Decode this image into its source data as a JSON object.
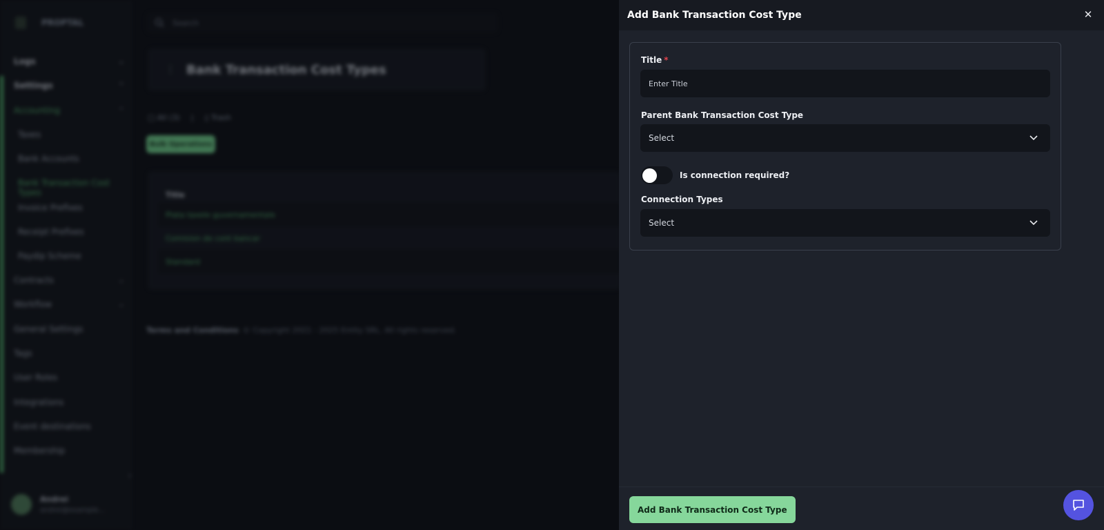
{
  "background": {
    "logo_text": "PROPTAL",
    "search_placeholder": "Search",
    "nav": [
      {
        "label": "Logs",
        "chevron": "v"
      },
      {
        "label": "Settings",
        "chevron": "^"
      },
      {
        "label": "Accounting",
        "chevron": "^"
      },
      {
        "label": "Taxes"
      },
      {
        "label": "Bank Accounts"
      },
      {
        "label": "Bank Transaction Cost Types"
      },
      {
        "label": "Invoice Prefixes"
      },
      {
        "label": "Receipt Prefixes"
      },
      {
        "label": "Paydip Scheme"
      },
      {
        "label": "Contracts",
        "chevron": "v"
      },
      {
        "label": "Workflow",
        "chevron": "v"
      },
      {
        "label": "General Settings"
      },
      {
        "label": "Tags"
      },
      {
        "label": "User Roles"
      },
      {
        "label": "Integrations"
      },
      {
        "label": "Event destinations"
      },
      {
        "label": "Membership"
      }
    ],
    "user": {
      "name": "Andrei",
      "email": "andrei@example..."
    },
    "page_title": "Bank Transaction Cost Types",
    "tool_all": "All (3)",
    "tool_trash": "Trash",
    "bulk_button": "Bulk Operations",
    "table_header": "Title",
    "rows": [
      "Plata taxele guvernamentale",
      "Comision de cont bancar",
      "Standard"
    ],
    "footer_terms": "Terms and Conditions",
    "footer_copy": "© Copyright 2021 - 2025 Entity SRL. All rights reserved."
  },
  "drawer": {
    "title": "Add Bank Transaction Cost Type",
    "title_label": "Title",
    "title_required": "*",
    "title_placeholder": "Enter Title",
    "parent_label": "Parent Bank Transaction Cost Type",
    "parent_value": "Select",
    "toggle_label": "Is connection required?",
    "toggle_on": false,
    "connection_label": "Connection Types",
    "connection_value": "Select",
    "submit_label": "Add Bank Transaction Cost Type"
  },
  "colors": {
    "accent_green": "#86d79b",
    "chat_button": "#5453e0",
    "required": "#e0434d"
  }
}
